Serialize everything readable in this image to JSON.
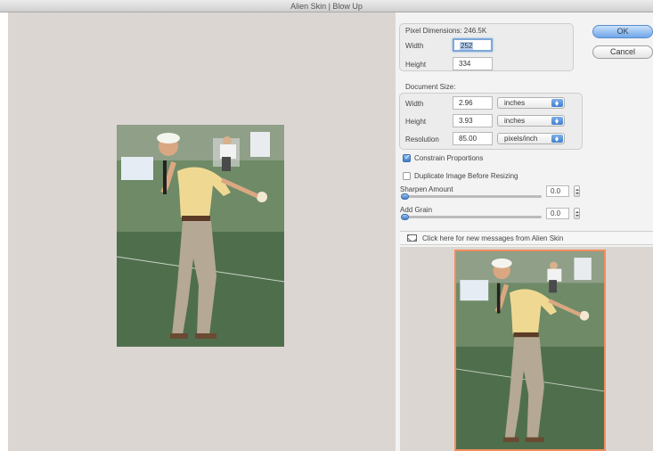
{
  "window": {
    "title": "Alien Skin | Blow Up"
  },
  "pixel_dimensions": {
    "label": "Pixel Dimensions: 246.5K",
    "width_label": "Width",
    "width_value": "252",
    "height_label": "Height",
    "height_value": "334"
  },
  "document_size": {
    "label": "Document Size:",
    "width_label": "Width",
    "width_value": "2.96",
    "width_unit": "inches",
    "height_label": "Height",
    "height_value": "3.93",
    "height_unit": "inches",
    "resolution_label": "Resolution",
    "resolution_value": "85.00",
    "resolution_unit": "pixels/inch"
  },
  "buttons": {
    "ok": "OK",
    "cancel": "Cancel"
  },
  "options": {
    "constrain_label": "Constrain Proportions",
    "constrain_checked": true,
    "duplicate_label": "Duplicate Image Before Resizing",
    "duplicate_checked": false
  },
  "sharpen": {
    "label": "Sharpen Amount",
    "value": "0.0"
  },
  "grain": {
    "label": "Add Grain",
    "value": "0.0"
  },
  "message": {
    "text": "Click here for new messages from Alien Skin"
  },
  "colors": {
    "accent": "#5a8ecf",
    "preview_border": "#f28d5c",
    "canvas_bg": "#dcd6d3"
  }
}
